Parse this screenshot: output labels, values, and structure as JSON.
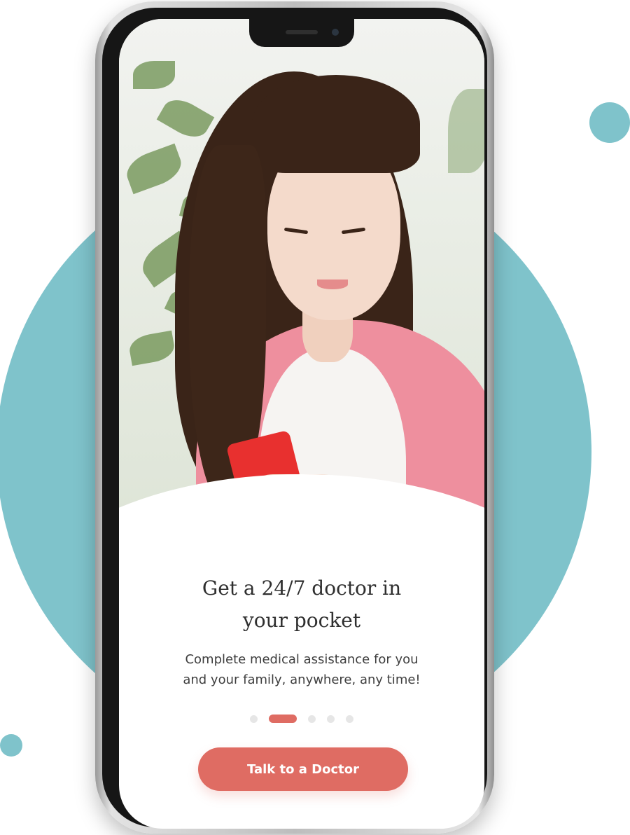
{
  "onboarding": {
    "headline": "Get a 24/7 doctor in\nyour pocket",
    "subtitle": "Complete medical assistance for you\nand your family, anywhere, any time!",
    "pagination": {
      "total": 5,
      "active_index": 1
    },
    "cta_label": "Talk to a Doctor"
  },
  "colors": {
    "accent": "#df6c63",
    "background_circle": "#7fc3cb",
    "inactive_dot": "#e6e6e6"
  }
}
